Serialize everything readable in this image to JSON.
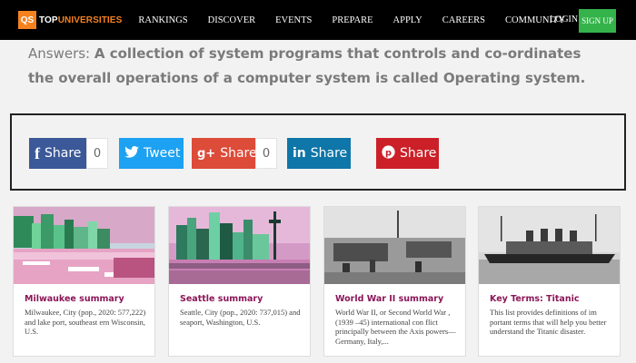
{
  "navbar": {
    "logo_badge": "QS",
    "logo_top": "TOP",
    "logo_universities": "UNIVERSITIES",
    "items": [
      "RANKINGS",
      "DISCOVER",
      "EVENTS",
      "PREPARE",
      "APPLY",
      "CAREERS",
      "COMMUNITY"
    ],
    "login": "LOGIN",
    "signup": "SIGN UP",
    "colors": {
      "background": "#000000",
      "brand": "#f5821f",
      "signup": "#34b34a"
    }
  },
  "answer": {
    "label": "Answers:",
    "text": "A collection of system programs that controls and co-ordinates the overall operations of a computer system is called Operating system."
  },
  "share_buttons": [
    {
      "network": "facebook",
      "icon": "f",
      "label": "Share",
      "count": "0",
      "color": "#3b5998"
    },
    {
      "network": "twitter",
      "icon": "twitter-bird-icon",
      "label": "Tweet",
      "color": "#1da1f2"
    },
    {
      "network": "google-plus",
      "icon": "g+",
      "label": "Share",
      "count": "0",
      "color": "#dd4b39"
    },
    {
      "network": "linkedin",
      "icon": "in",
      "label": "Share",
      "color": "#0e76a8"
    },
    {
      "network": "pinterest",
      "icon": "pinterest-icon",
      "label": "Share",
      "color": "#cb2027"
    }
  ],
  "cards": [
    {
      "title": "Milwaukee summary",
      "description": "Milwaukee, City (pop., 2020: 577,222) and lake port, southeast ern Wisconsin, U.S."
    },
    {
      "title": "Seattle summary",
      "description": "Seattle, City (pop., 2020: 737,015) and seaport, Washington, U.S."
    },
    {
      "title": "World War II summary",
      "description": "World War II, or Second World War , (1939 –45) international con flict principally between the Axis powers—Germany, Italy,..."
    },
    {
      "title": "Key Terms: Titanic",
      "description": "This list provides definitions of im portant terms that will help you better understand the Titanic disaster."
    }
  ]
}
